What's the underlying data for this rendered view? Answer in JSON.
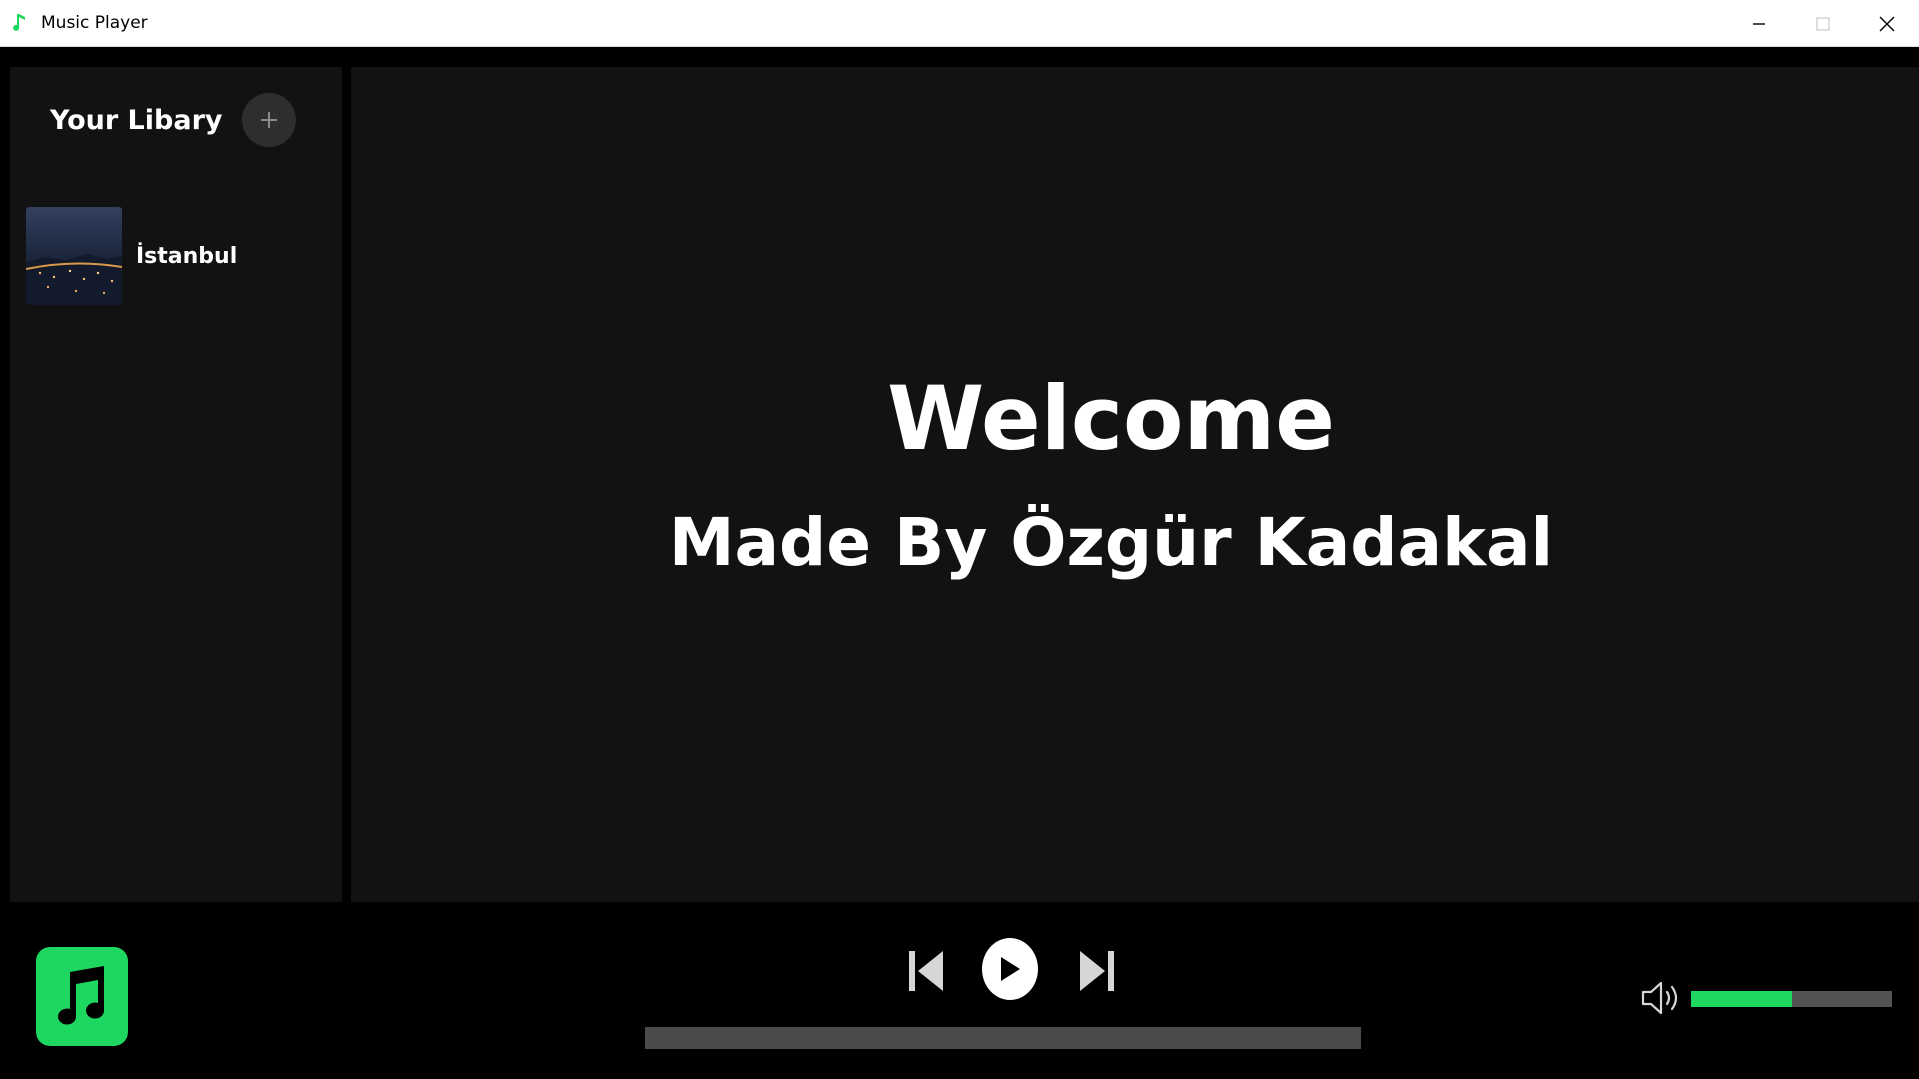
{
  "window": {
    "title": "Music Player",
    "accent_color": "#1ed760"
  },
  "sidebar": {
    "title": "Your Libary",
    "add_button_icon": "plus-icon",
    "items": [
      {
        "label": "İstanbul",
        "thumbnail": "city-night-thumbnail"
      }
    ]
  },
  "main": {
    "heading": "Welcome",
    "subheading": "Made By Özgür Kadakal"
  },
  "player": {
    "logo_icon": "music-note-icon",
    "controls": [
      "previous-icon",
      "play-icon",
      "next-icon"
    ],
    "progress": 0,
    "volume": 0.5
  }
}
